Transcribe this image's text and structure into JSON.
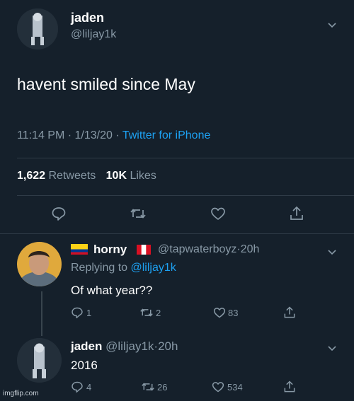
{
  "main_tweet": {
    "display_name": "jaden",
    "handle": "@liljay1k",
    "text": "havent smiled since May",
    "time": "11:14 PM",
    "date": "1/13/20",
    "sep": "·",
    "client": "Twitter for iPhone",
    "retweets_count": "1,622",
    "retweets_label": "Retweets",
    "likes_count": "10K",
    "likes_label": "Likes"
  },
  "reply_1": {
    "display_name": "horny",
    "handle": "@tapwaterboyz",
    "age": "20h",
    "replying_prefix": "Replying to",
    "replying_to": "@liljay1k",
    "text": "Of what year??",
    "reply_count": "1",
    "retweet_count": "2",
    "like_count": "83"
  },
  "reply_2": {
    "display_name": "jaden",
    "handle": "@liljay1k",
    "age": "20h",
    "text": "2016",
    "reply_count": "4",
    "retweet_count": "26",
    "like_count": "534"
  },
  "watermark": "imgflip.com",
  "icons": [
    "reply-icon",
    "retweet-icon",
    "like-icon",
    "share-icon",
    "chevron-down-icon"
  ],
  "colors": {
    "background": "#15202b",
    "muted": "#8899a6",
    "link": "#1da1f2"
  }
}
